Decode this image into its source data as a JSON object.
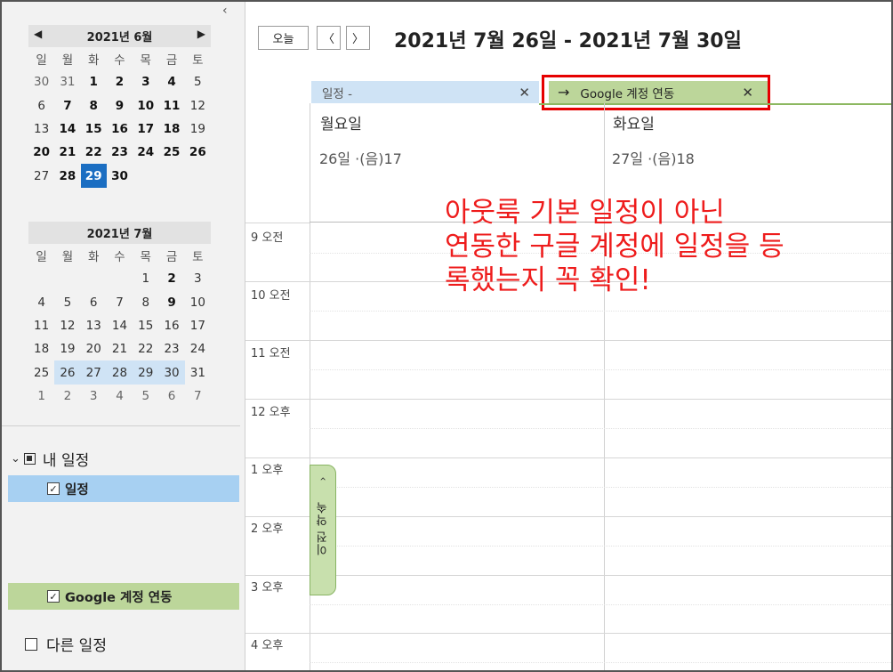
{
  "colors": {
    "accent_blue": "#1b6ec2",
    "week_highlight": "#cfe3f5",
    "google_green": "#bcd69a",
    "annotation_red": "#ee1c1c"
  },
  "nav": {
    "collapse_icon": "‹",
    "weekdays": [
      "일",
      "월",
      "화",
      "수",
      "목",
      "금",
      "토"
    ],
    "june": {
      "title": "2021년 6월",
      "prev_icon": "◀",
      "next_icon": "▶",
      "rows": [
        [
          "30",
          "31",
          "1",
          "2",
          "3",
          "4",
          "5"
        ],
        [
          "6",
          "7",
          "8",
          "9",
          "10",
          "11",
          "12"
        ],
        [
          "13",
          "14",
          "15",
          "16",
          "17",
          "18",
          "19"
        ],
        [
          "20",
          "21",
          "22",
          "23",
          "24",
          "25",
          "26"
        ],
        [
          "27",
          "28",
          "29",
          "30",
          "",
          "",
          ""
        ]
      ]
    },
    "july": {
      "title": "2021년 7월",
      "rows": [
        [
          "",
          "",
          "",
          "",
          "1",
          "2",
          "3"
        ],
        [
          "4",
          "5",
          "6",
          "7",
          "8",
          "9",
          "10"
        ],
        [
          "11",
          "12",
          "13",
          "14",
          "15",
          "16",
          "17"
        ],
        [
          "18",
          "19",
          "20",
          "21",
          "22",
          "23",
          "24"
        ],
        [
          "25",
          "26",
          "27",
          "28",
          "29",
          "30",
          "31"
        ],
        [
          "1",
          "2",
          "3",
          "4",
          "5",
          "6",
          "7"
        ]
      ]
    },
    "my_calendars": {
      "label": "내 일정",
      "chevron": "⌄",
      "items": [
        {
          "label": "일정",
          "checked": true
        },
        {
          "label": "Google 계정 연동",
          "checked": true
        }
      ]
    },
    "other_calendars": {
      "label": "다른 일정"
    }
  },
  "toolbar": {
    "today_label": "오늘",
    "prev_label": "〈",
    "next_label": "〉",
    "date_range": "2021년 7월 26일 - 2021년 7월 30일"
  },
  "tabs": {
    "default": {
      "label": "일정 -",
      "close": "✕"
    },
    "google": {
      "arrow": "→",
      "label": "Google 계정 연동",
      "close": "✕"
    }
  },
  "days": [
    {
      "name": "월요일",
      "date": "26일 ·(음)17"
    },
    {
      "name": "화요일",
      "date": "27일 ·(음)18"
    }
  ],
  "hours": [
    "9 오전",
    "10 오전",
    "11 오전",
    "12 오후",
    "1 오후",
    "2 오후",
    "3 오후",
    "4 오후"
  ],
  "prev_appointment": {
    "chevron": "‹",
    "label": "이전 약속"
  },
  "annotation": {
    "line1": "아웃룩 기본 일정이 아닌",
    "line2": "연동한 구글 계정에 일정을 등",
    "line3": "록했는지 꼭 확인!"
  }
}
